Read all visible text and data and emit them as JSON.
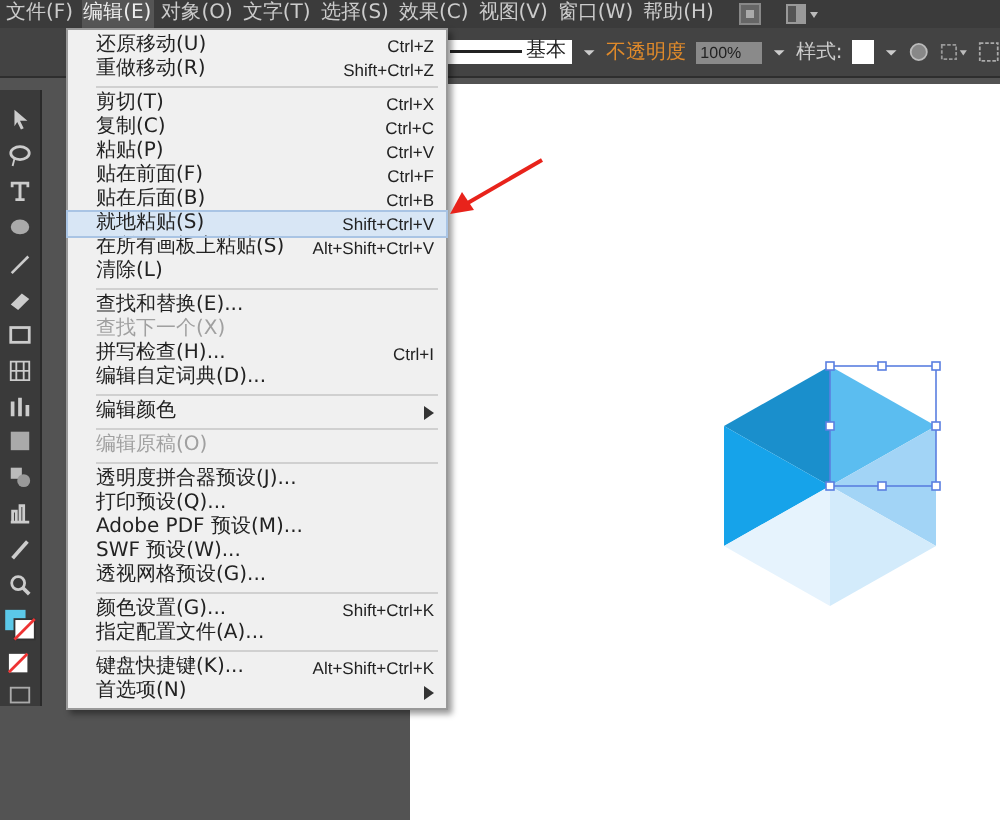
{
  "menubar": [
    {
      "label": "文件(F)",
      "selected": false
    },
    {
      "label": "编辑(E)",
      "selected": true
    },
    {
      "label": "对象(O)",
      "selected": false
    },
    {
      "label": "文字(T)",
      "selected": false
    },
    {
      "label": "选择(S)",
      "selected": false
    },
    {
      "label": "效果(C)",
      "selected": false
    },
    {
      "label": "视图(V)",
      "selected": false
    },
    {
      "label": "窗口(W)",
      "selected": false
    },
    {
      "label": "帮助(H)",
      "selected": false
    }
  ],
  "control_bar": {
    "stroke_style": "基本",
    "opacity_label": "不透明度",
    "opacity_value": "100%",
    "style_label": "样式:"
  },
  "edit_menu": {
    "groups": [
      [
        {
          "label": "还原移动(U)",
          "shortcut": "Ctrl+Z",
          "disabled": false,
          "selected": false,
          "submenu": false
        },
        {
          "label": "重做移动(R)",
          "shortcut": "Shift+Ctrl+Z",
          "disabled": false,
          "selected": false,
          "submenu": false
        }
      ],
      [
        {
          "label": "剪切(T)",
          "shortcut": "Ctrl+X",
          "disabled": false,
          "selected": false,
          "submenu": false
        },
        {
          "label": "复制(C)",
          "shortcut": "Ctrl+C",
          "disabled": false,
          "selected": false,
          "submenu": false
        },
        {
          "label": "粘贴(P)",
          "shortcut": "Ctrl+V",
          "disabled": false,
          "selected": false,
          "submenu": false
        },
        {
          "label": "贴在前面(F)",
          "shortcut": "Ctrl+F",
          "disabled": false,
          "selected": false,
          "submenu": false
        },
        {
          "label": "贴在后面(B)",
          "shortcut": "Ctrl+B",
          "disabled": false,
          "selected": false,
          "submenu": false
        },
        {
          "label": "就地粘贴(S)",
          "shortcut": "Shift+Ctrl+V",
          "disabled": false,
          "selected": true,
          "submenu": false
        },
        {
          "label": "在所有画板上粘贴(S)",
          "shortcut": "Alt+Shift+Ctrl+V",
          "disabled": false,
          "selected": false,
          "submenu": false
        },
        {
          "label": "清除(L)",
          "disabled": false,
          "selected": false,
          "submenu": false
        }
      ],
      [
        {
          "label": "查找和替换(E)...",
          "disabled": false,
          "selected": false,
          "submenu": false
        },
        {
          "label": "查找下一个(X)",
          "disabled": true,
          "selected": false,
          "submenu": false
        },
        {
          "label": "拼写检查(H)...",
          "shortcut": "Ctrl+I",
          "disabled": false,
          "selected": false,
          "submenu": false
        },
        {
          "label": "编辑自定词典(D)...",
          "disabled": false,
          "selected": false,
          "submenu": false
        }
      ],
      [
        {
          "label": "编辑颜色",
          "disabled": false,
          "selected": false,
          "submenu": true
        }
      ],
      [
        {
          "label": "编辑原稿(O)",
          "disabled": true,
          "selected": false,
          "submenu": false
        }
      ],
      [
        {
          "label": "透明度拼合器预设(J)...",
          "disabled": false,
          "selected": false,
          "submenu": false
        },
        {
          "label": "打印预设(Q)...",
          "disabled": false,
          "selected": false,
          "submenu": false
        },
        {
          "label": "Adobe PDF 预设(M)...",
          "disabled": false,
          "selected": false,
          "submenu": false
        },
        {
          "label": "SWF 预设(W)...",
          "disabled": false,
          "selected": false,
          "submenu": false
        },
        {
          "label": "透视网格预设(G)...",
          "disabled": false,
          "selected": false,
          "submenu": false
        }
      ],
      [
        {
          "label": "颜色设置(G)...",
          "shortcut": "Shift+Ctrl+K",
          "disabled": false,
          "selected": false,
          "submenu": false
        },
        {
          "label": "指定配置文件(A)...",
          "disabled": false,
          "selected": false,
          "submenu": false
        }
      ],
      [
        {
          "label": "键盘快捷键(K)...",
          "shortcut": "Alt+Shift+Ctrl+K",
          "disabled": false,
          "selected": false,
          "submenu": false
        },
        {
          "label": "首选项(N)",
          "disabled": false,
          "selected": false,
          "submenu": true
        }
      ]
    ]
  }
}
